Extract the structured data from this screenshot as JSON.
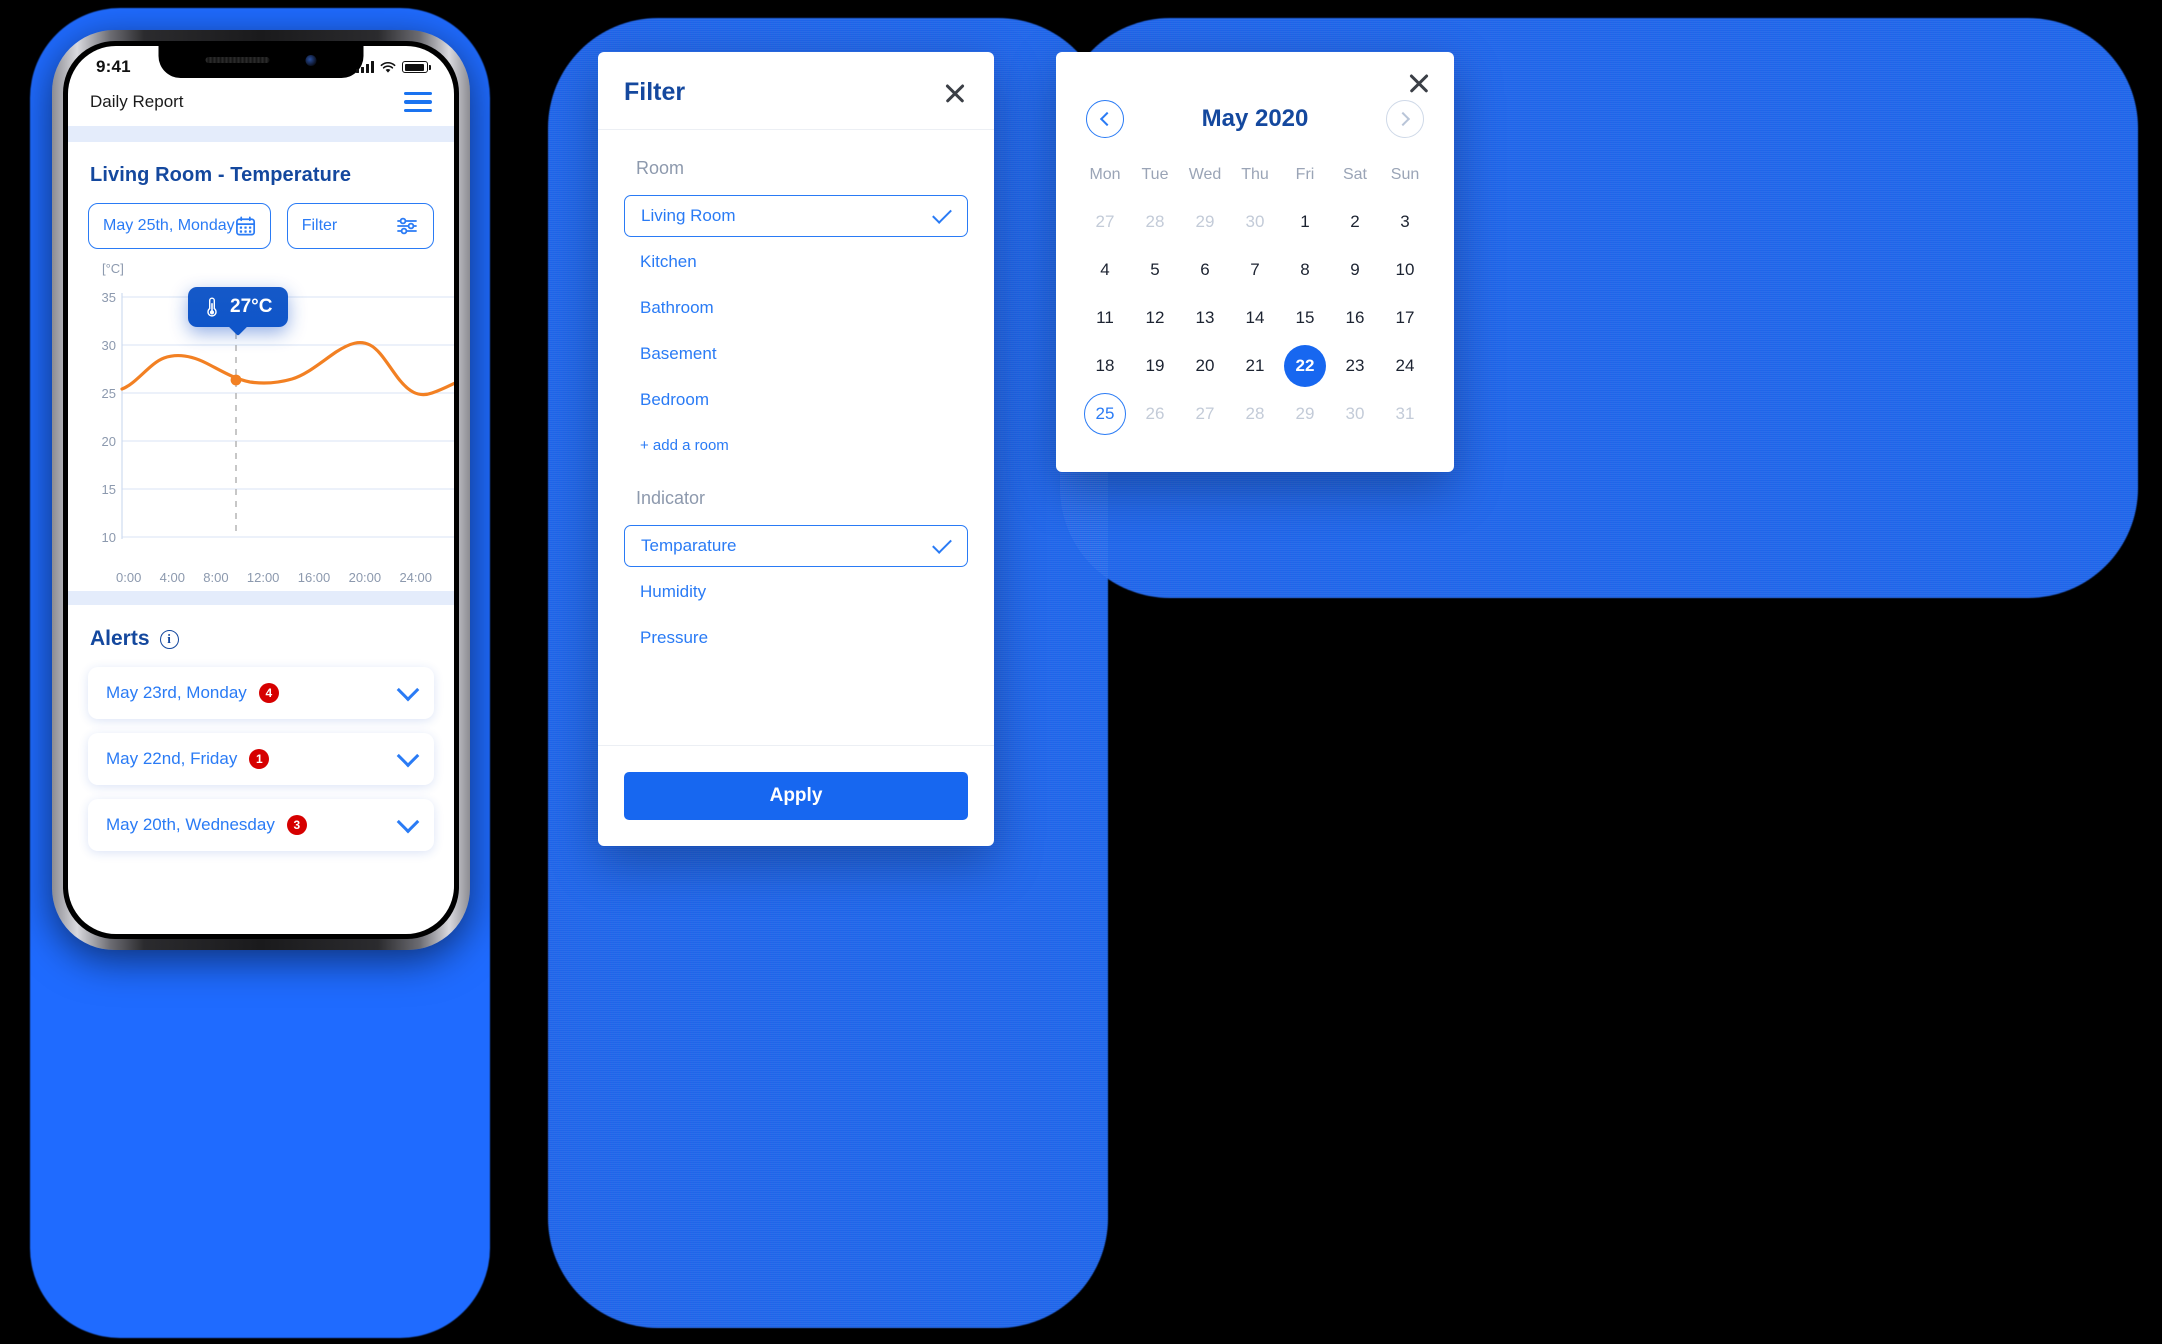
{
  "phone": {
    "status": {
      "time": "9:41",
      "signal_icon": "signal-bars-icon",
      "wifi_icon": "wifi-icon",
      "battery_icon": "battery-icon"
    },
    "appbar": {
      "title": "Daily Report",
      "menu_icon": "hamburger-menu-icon"
    },
    "report": {
      "title": "Living Room - Temperature",
      "date_button": "May 25th, Monday",
      "date_icon": "calendar-icon",
      "filter_button": "Filter",
      "filter_icon": "sliders-icon"
    },
    "alerts": {
      "heading": "Alerts",
      "info_icon": "info-circle-icon",
      "items": [
        {
          "label": "May 23rd, Monday",
          "count": "4",
          "chevron": "chevron-down-icon"
        },
        {
          "label": "May 22nd, Friday",
          "count": "1",
          "chevron": "chevron-down-icon"
        },
        {
          "label": "May 20th, Wednesday",
          "count": "3",
          "chevron": "chevron-down-icon"
        }
      ]
    }
  },
  "filter_panel": {
    "title": "Filter",
    "close_icon": "close-icon",
    "room_label": "Room",
    "rooms": [
      {
        "label": "Living Room",
        "selected": true
      },
      {
        "label": "Kitchen",
        "selected": false
      },
      {
        "label": "Bathroom",
        "selected": false
      },
      {
        "label": "Basement",
        "selected": false
      },
      {
        "label": "Bedroom",
        "selected": false
      }
    ],
    "add_room": "+ add a room",
    "indicator_label": "Indicator",
    "indicators": [
      {
        "label": "Temparature",
        "selected": true
      },
      {
        "label": "Humidity",
        "selected": false
      },
      {
        "label": "Pressure",
        "selected": false
      }
    ],
    "apply_label": "Apply",
    "check_icon": "check-icon"
  },
  "calendar": {
    "close_icon": "close-icon",
    "prev_icon": "chevron-left-icon",
    "next_icon": "chevron-right-icon",
    "title": "May 2020",
    "weekdays": [
      "Mon",
      "Tue",
      "Wed",
      "Thu",
      "Fri",
      "Sat",
      "Sun"
    ],
    "weeks": [
      [
        {
          "d": "27",
          "muted": true
        },
        {
          "d": "28",
          "muted": true
        },
        {
          "d": "29",
          "muted": true
        },
        {
          "d": "30",
          "muted": true
        },
        {
          "d": "1"
        },
        {
          "d": "2"
        },
        {
          "d": "3"
        }
      ],
      [
        {
          "d": "4"
        },
        {
          "d": "5"
        },
        {
          "d": "6"
        },
        {
          "d": "7"
        },
        {
          "d": "8"
        },
        {
          "d": "9"
        },
        {
          "d": "10"
        }
      ],
      [
        {
          "d": "11"
        },
        {
          "d": "12"
        },
        {
          "d": "13"
        },
        {
          "d": "14"
        },
        {
          "d": "15"
        },
        {
          "d": "16"
        },
        {
          "d": "17"
        }
      ],
      [
        {
          "d": "18"
        },
        {
          "d": "19"
        },
        {
          "d": "20"
        },
        {
          "d": "21"
        },
        {
          "d": "22",
          "state": "today"
        },
        {
          "d": "23"
        },
        {
          "d": "24"
        }
      ],
      [
        {
          "d": "25",
          "state": "outlined"
        },
        {
          "d": "26",
          "muted": true
        },
        {
          "d": "27",
          "muted": true
        },
        {
          "d": "28",
          "muted": true
        },
        {
          "d": "29",
          "muted": true
        },
        {
          "d": "30",
          "muted": true
        },
        {
          "d": "31",
          "muted": true
        }
      ]
    ]
  },
  "colors": {
    "brand_blue": "#1767f0",
    "dark_blue": "#14489e",
    "link_blue": "#2a7bf5",
    "line_orange": "#f28023",
    "badge_red": "#d60000",
    "backdrop_blue": "#1f6bff"
  },
  "chart_data": {
    "type": "line",
    "title": "Living Room - Temperature",
    "ylabel": "[°C]",
    "xlabel": "",
    "ylim": [
      10,
      35
    ],
    "yticks": [
      35,
      30,
      25,
      20,
      15,
      10
    ],
    "xticks": [
      "0:00",
      "4:00",
      "8:00",
      "12:00",
      "16:00",
      "20:00",
      "24:00"
    ],
    "grid": true,
    "legend": "none",
    "series": [
      {
        "name": "Temperature",
        "color": "#f28023",
        "x": [
          0,
          2,
          4,
          6,
          8,
          10,
          12,
          14,
          16,
          18,
          20,
          22,
          24
        ],
        "values": [
          25.4,
          27.6,
          28.6,
          28.2,
          26.9,
          26.9,
          27.4,
          29.0,
          29.6,
          27.3,
          25.4,
          26.6,
          27.4
        ]
      }
    ],
    "annotations": [
      {
        "type": "tooltip",
        "x": "8:00",
        "value": 27,
        "label": "27°C",
        "icon": "thermometer-icon"
      }
    ]
  }
}
